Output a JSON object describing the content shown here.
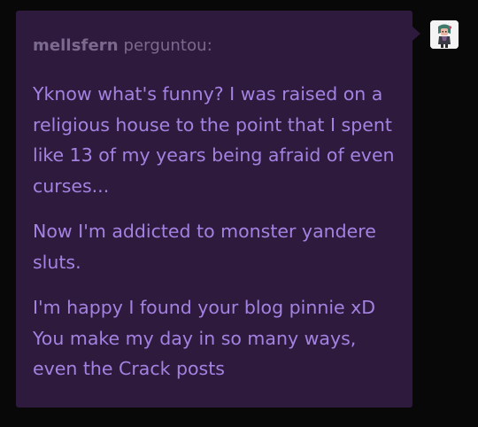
{
  "ask": {
    "asker_name": "mellsfern",
    "asker_verb": "perguntou:",
    "paragraphs": [
      "Yknow what's funny? I was raised on a religious house to the point that I spent like 13 of my years being afraid of even curses...",
      "Now I'm addicted to monster yandere sluts.",
      "I'm happy I found your blog pinnie xD You make my day in so many ways, even the Crack posts"
    ]
  },
  "colors": {
    "background": "#080808",
    "bubble": "#2e1a3c",
    "asker_text": "#7b6a8d",
    "message_text": "#a382e1"
  },
  "avatar": {
    "icon": "user-avatar-icon"
  }
}
